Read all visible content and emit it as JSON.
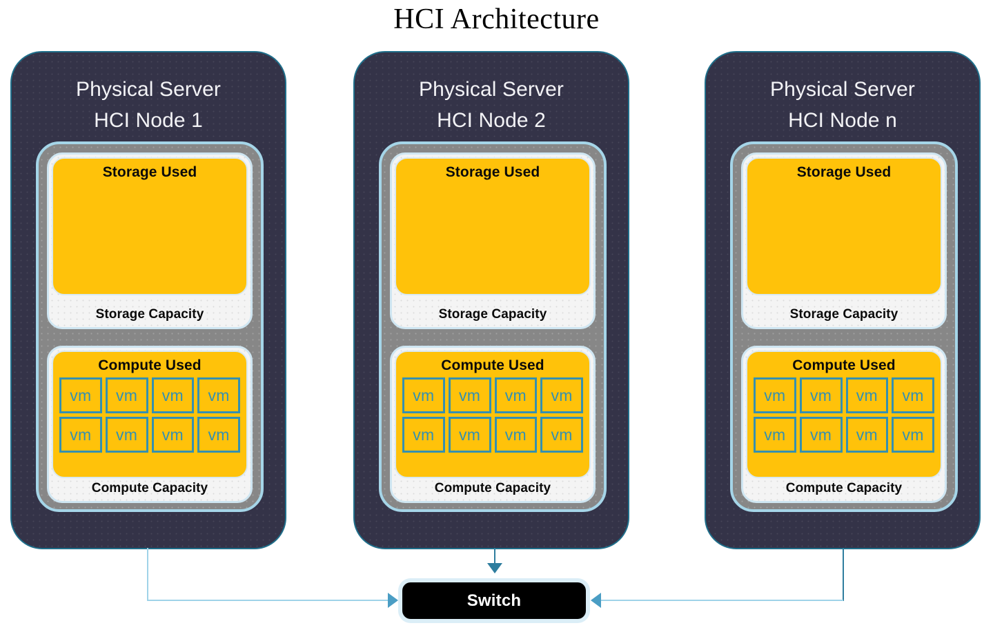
{
  "title": "HCI Architecture",
  "nodes": [
    {
      "header_line1": "Physical Server",
      "header_line2": "HCI Node 1",
      "storage": {
        "used_label": "Storage Used",
        "capacity_label": "Storage Capacity"
      },
      "compute": {
        "used_label": "Compute Used",
        "capacity_label": "Compute Capacity",
        "vms": [
          "vm",
          "vm",
          "vm",
          "vm",
          "vm",
          "vm",
          "vm",
          "vm"
        ]
      }
    },
    {
      "header_line1": "Physical Server",
      "header_line2": "HCI Node 2",
      "storage": {
        "used_label": "Storage Used",
        "capacity_label": "Storage Capacity"
      },
      "compute": {
        "used_label": "Compute Used",
        "capacity_label": "Compute Capacity",
        "vms": [
          "vm",
          "vm",
          "vm",
          "vm",
          "vm",
          "vm",
          "vm",
          "vm"
        ]
      }
    },
    {
      "header_line1": "Physical Server",
      "header_line2": "HCI Node n",
      "storage": {
        "used_label": "Storage Used",
        "capacity_label": "Storage Capacity"
      },
      "compute": {
        "used_label": "Compute Used",
        "capacity_label": "Compute Capacity",
        "vms": [
          "vm",
          "vm",
          "vm",
          "vm",
          "vm",
          "vm",
          "vm",
          "vm"
        ]
      }
    }
  ],
  "switch": {
    "label": "Switch"
  },
  "colors": {
    "node_background": "#343348",
    "node_border": "#1f6f8b",
    "resource_container": "#878787",
    "resource_border": "#a5d5e8",
    "capacity_background": "#f4f4f4",
    "capacity_border": "#cfe6f2",
    "used_yellow": "#ffc20a",
    "vm_border": "#3590b0",
    "connector": "#9fd3e8",
    "arrow": "#4a9dc4",
    "switch_background": "#000000",
    "switch_halo": "#dbeef7",
    "title_text": "#000000",
    "node_title_text": "#f3f3f6"
  }
}
